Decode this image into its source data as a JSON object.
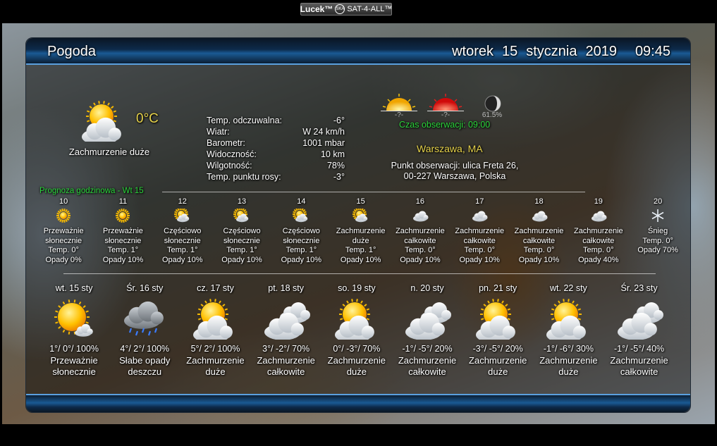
{
  "credit": {
    "brand": "Lucek™",
    "globe": "SKA",
    "site": "SAT-4-ALL™"
  },
  "header": {
    "title": "Pogoda",
    "weekday": "wtorek",
    "day": "15",
    "month": "stycznia",
    "year": "2019",
    "time": "09:45"
  },
  "current": {
    "icon": "sun-cloud-icon",
    "temp": "0°C",
    "description": "Zachmurzenie duże",
    "details": [
      {
        "label": "Temp. odczuwalna:",
        "value": "-6°"
      },
      {
        "label": "Wiatr:",
        "value": "W 24 km/h"
      },
      {
        "label": "Barometr:",
        "value": "1001 mbar"
      },
      {
        "label": "Widoczność:",
        "value": "10 km"
      },
      {
        "label": "Wilgotność:",
        "value": "78%"
      },
      {
        "label": "Temp. punktu rosy:",
        "value": "-3°"
      }
    ]
  },
  "astro": {
    "sunrise": "-?-",
    "sunset": "-?-",
    "moon": "61.5%"
  },
  "observation": {
    "time": "Czas obserwacji: 09:00",
    "city": "Warszawa, MA",
    "point_line1": "Punkt obserwacji: ulica Freta 26,",
    "point_line2": "00-227 Warszawa, Polska"
  },
  "hourly": {
    "title": "Prognoza godzinowa - Wt 15",
    "items": [
      {
        "hour": "10",
        "icon": "sun-icon",
        "desc1": "Przeważnie",
        "desc2": "słonecznie",
        "temp": "Temp. 0°",
        "rain": "Opady 0%"
      },
      {
        "hour": "11",
        "icon": "sun-icon",
        "desc1": "Przeważnie",
        "desc2": "słonecznie",
        "temp": "Temp. 1°",
        "rain": "Opady 10%"
      },
      {
        "hour": "12",
        "icon": "sun-cloud-icon",
        "desc1": "Częściowo",
        "desc2": "słonecznie",
        "temp": "Temp. 1°",
        "rain": "Opady 10%"
      },
      {
        "hour": "13",
        "icon": "sun-cloud-icon",
        "desc1": "Częściowo",
        "desc2": "słonecznie",
        "temp": "Temp. 1°",
        "rain": "Opady 10%"
      },
      {
        "hour": "14",
        "icon": "sun-cloud-icon",
        "desc1": "Częściowo",
        "desc2": "słonecznie",
        "temp": "Temp. 1°",
        "rain": "Opady 10%"
      },
      {
        "hour": "15",
        "icon": "sun-cloud-icon",
        "desc1": "Zachmurzenie",
        "desc2": "duże",
        "temp": "Temp. 1°",
        "rain": "Opady 10%"
      },
      {
        "hour": "16",
        "icon": "cloud-icon",
        "desc1": "Zachmurzenie",
        "desc2": "całkowite",
        "temp": "Temp. 0°",
        "rain": "Opady 10%"
      },
      {
        "hour": "17",
        "icon": "cloud-icon",
        "desc1": "Zachmurzenie",
        "desc2": "całkowite",
        "temp": "Temp. 0°",
        "rain": "Opady 10%"
      },
      {
        "hour": "18",
        "icon": "cloud-icon",
        "desc1": "Zachmurzenie",
        "desc2": "całkowite",
        "temp": "Temp. 0°",
        "rain": "Opady 10%"
      },
      {
        "hour": "19",
        "icon": "cloud-icon",
        "desc1": "Zachmurzenie",
        "desc2": "całkowite",
        "temp": "Temp. 0°",
        "rain": "Opady 40%"
      },
      {
        "hour": "20",
        "icon": "snowflake-icon",
        "desc1": "Śnieg",
        "desc2": "",
        "temp": "Temp. 0°",
        "rain": "Opady 70%"
      }
    ]
  },
  "daily": [
    {
      "day": "wt. 15 sty",
      "icon": "sun-small-cloud-icon",
      "temps": "1°/ 0°/ 100%",
      "desc1": "Przeważnie",
      "desc2": "słonecznie"
    },
    {
      "day": "Śr. 16 sty",
      "icon": "rain-cloud-icon",
      "temps": "4°/ 2°/ 100%",
      "desc1": "Słabe opady",
      "desc2": "deszczu"
    },
    {
      "day": "cz. 17 sty",
      "icon": "sun-cloud-icon",
      "temps": "5°/ 2°/ 100%",
      "desc1": "Zachmurzenie",
      "desc2": "duże"
    },
    {
      "day": "pt. 18 sty",
      "icon": "cloud-icon",
      "temps": "3°/ -2°/ 70%",
      "desc1": "Zachmurzenie",
      "desc2": "całkowite"
    },
    {
      "day": "so. 19 sty",
      "icon": "sun-cloud-icon",
      "temps": "0°/ -3°/ 70%",
      "desc1": "Zachmurzenie",
      "desc2": "duże"
    },
    {
      "day": "n. 20 sty",
      "icon": "cloud-icon",
      "temps": "-1°/ -5°/ 20%",
      "desc1": "Zachmurzenie",
      "desc2": "całkowite"
    },
    {
      "day": "pn. 21 sty",
      "icon": "sun-cloud-icon",
      "temps": "-3°/ -5°/ 20%",
      "desc1": "Zachmurzenie",
      "desc2": "duże"
    },
    {
      "day": "wt. 22 sty",
      "icon": "sun-cloud-icon",
      "temps": "-1°/ -6°/ 30%",
      "desc1": "Zachmurzenie",
      "desc2": "duże"
    },
    {
      "day": "Śr. 23 sty",
      "icon": "cloud-icon",
      "temps": "-1°/ -5°/ 40%",
      "desc1": "Zachmurzenie",
      "desc2": "całkowite"
    }
  ],
  "colors": {
    "accent_yellow": "#e6d24a",
    "accent_green": "#2ad33a",
    "header_blue": "#1a5a94"
  }
}
